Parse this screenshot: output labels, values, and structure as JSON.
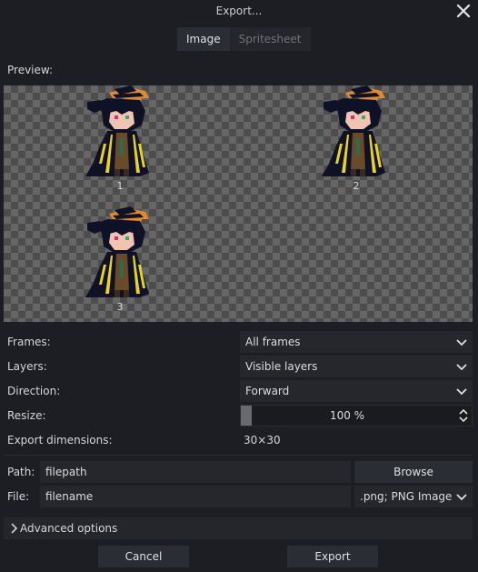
{
  "window": {
    "title": "Export..."
  },
  "tabs": [
    {
      "label": "Image",
      "active": true
    },
    {
      "label": "Spritesheet",
      "active": false
    }
  ],
  "preview": {
    "label": "Preview:",
    "frames": [
      {
        "number": "1"
      },
      {
        "number": "2"
      },
      {
        "number": "3"
      }
    ]
  },
  "options": {
    "frames": {
      "label": "Frames:",
      "value": "All frames"
    },
    "layers": {
      "label": "Layers:",
      "value": "Visible layers"
    },
    "direction": {
      "label": "Direction:",
      "value": "Forward"
    },
    "resize": {
      "label": "Resize:",
      "value": "100 %"
    },
    "dimensions": {
      "label": "Export dimensions:",
      "value": "30×30"
    }
  },
  "output": {
    "path_label": "Path:",
    "path_value": "filepath",
    "browse_label": "Browse",
    "file_label": "File:",
    "file_value": "filename",
    "format_value": ".png; PNG Image"
  },
  "advanced": {
    "label": "Advanced options"
  },
  "footer": {
    "cancel_label": "Cancel",
    "export_label": "Export"
  },
  "colors": {
    "background": "#1d1e23",
    "panel": "#25272d",
    "button": "#2b2d35",
    "accent_orange": "#e38a2c",
    "accent_yellow": "#e8d321",
    "cloak": "#0f1126"
  }
}
